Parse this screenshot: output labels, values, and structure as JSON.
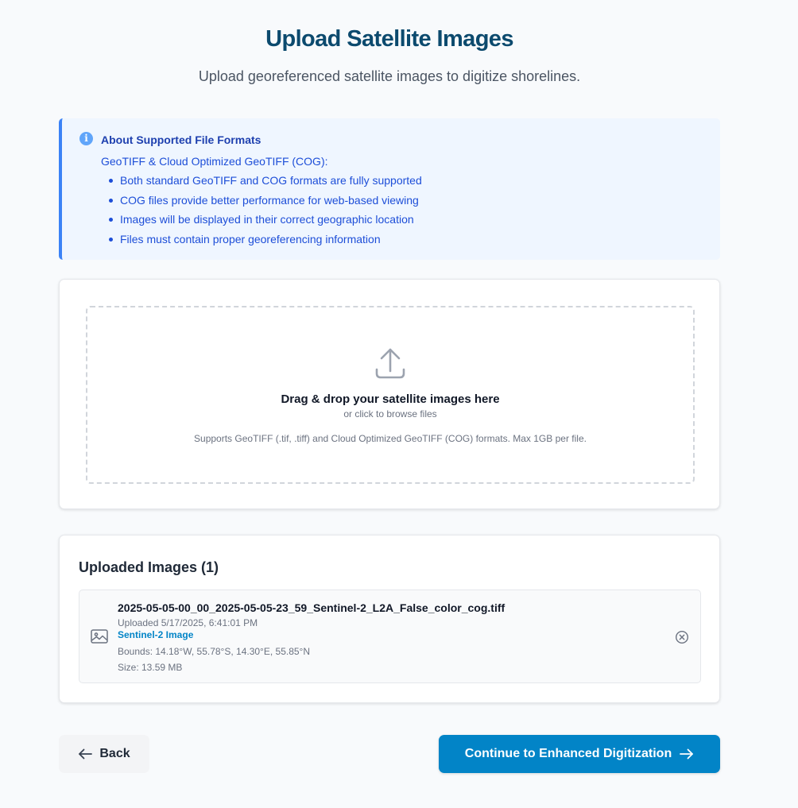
{
  "header": {
    "title": "Upload Satellite Images",
    "subtitle": "Upload georeferenced satellite images to digitize shorelines."
  },
  "info": {
    "icon": "info-icon",
    "heading": "About Supported File Formats",
    "subheading": "GeoTIFF & Cloud Optimized GeoTIFF (COG):",
    "items": [
      "Both standard GeoTIFF and COG formats are fully supported",
      "COG files provide better performance for web-based viewing",
      "Images will be displayed in their correct geographic location",
      "Files must contain proper georeferencing information"
    ]
  },
  "dropzone": {
    "icon": "upload-icon",
    "title": "Drag & drop your satellite images here",
    "subtitle": "or click to browse files",
    "note": "Supports GeoTIFF (.tif, .tiff) and Cloud Optimized GeoTIFF (COG) formats. Max 1GB per file."
  },
  "uploaded": {
    "title": "Uploaded Images (1)",
    "files": [
      {
        "icon": "image-icon",
        "name": "2025-05-05-00_00_2025-05-05-23_59_Sentinel-2_L2A_False_color_cog.tiff",
        "uploaded": "Uploaded 5/17/2025, 6:41:01 PM",
        "type": "Sentinel-2 Image",
        "bounds": "Bounds: 14.18°W, 55.78°S, 14.30°E, 55.85°N",
        "size": "Size: 13.59 MB"
      }
    ]
  },
  "actions": {
    "back_label": "Back",
    "continue_label": "Continue to Enhanced Digitization"
  },
  "colors": {
    "primary": "#0284c7",
    "title": "#0c4a6e",
    "info_accent": "#3b82f6",
    "info_text": "#1d4ed8",
    "info_bg": "#eff6ff"
  }
}
